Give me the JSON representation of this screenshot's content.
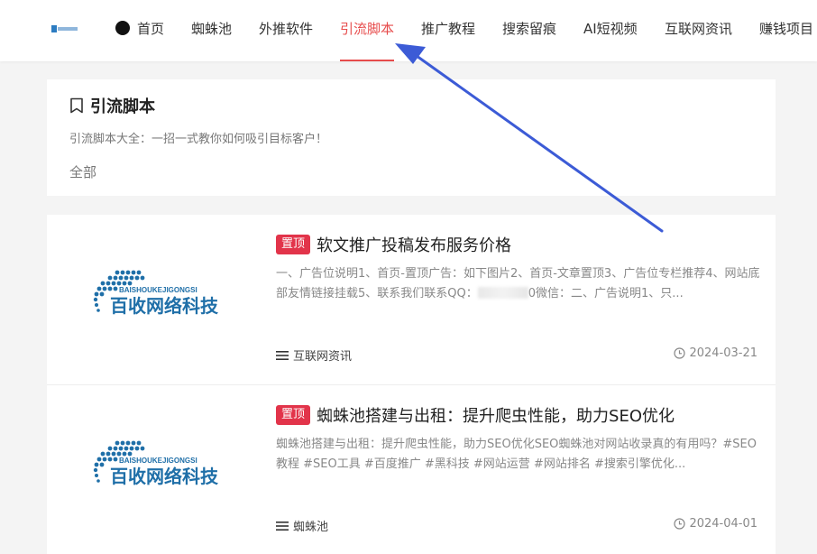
{
  "header": {
    "nav": [
      {
        "label": "首页",
        "name": "nav-item-home"
      },
      {
        "label": "蜘蛛池",
        "name": "nav-item-spider-pool"
      },
      {
        "label": "外推软件",
        "name": "nav-item-promo-software"
      },
      {
        "label": "引流脚本",
        "name": "nav-item-traffic-scripts"
      },
      {
        "label": "推广教程",
        "name": "nav-item-promo-tutorials"
      },
      {
        "label": "搜索留痕",
        "name": "nav-item-search-traces"
      },
      {
        "label": "AI短视频",
        "name": "nav-item-ai-video"
      },
      {
        "label": "互联网资讯",
        "name": "nav-item-internet-news"
      },
      {
        "label": "赚钱项目",
        "name": "nav-item-money-projects"
      }
    ],
    "active_index": 3,
    "accent_color": "#e74c4c"
  },
  "category": {
    "title": "引流脚本",
    "description": "引流脚本大全：一招一式教你如何吸引目标客户！",
    "filter_all": "全部"
  },
  "posts": [
    {
      "badge": "置顶",
      "title": "软文推广投稿发布服务价格",
      "excerpt_before": "一、广告位说明1、首页-置顶广告：如下图片2、首页-文章置顶3、广告位专栏推荐4、网站底部友情链接挂载5、联系我们联系QQ：",
      "excerpt_visible_tail": "0",
      "excerpt_after": "微信：二、广告说明1、只...",
      "thumb_brand_en": "BAISHOUKEJIGONGSI",
      "thumb_brand_cn": "百收网络科技",
      "category": "互联网资讯",
      "date": "2024-03-21"
    },
    {
      "badge": "置顶",
      "title": "蜘蛛池搭建与出租：提升爬虫性能，助力SEO优化",
      "excerpt": "蜘蛛池搭建与出租：提升爬虫性能，助力SEO优化SEO蜘蛛池对网站收录真的有用吗？#SEO教程 #SEO工具 #百度推广 #黑科技 #网站运营 #网站排名 #搜索引擎优化...",
      "thumb_brand_en": "BAISHOUKEJIGONGSI",
      "thumb_brand_cn": "百收网络科技",
      "category": "蜘蛛池",
      "date": "2024-04-01"
    }
  ],
  "colors": {
    "badge": "#e2344a",
    "brand_blue": "#1f6fa8",
    "arrow": "#3c5bd6"
  }
}
